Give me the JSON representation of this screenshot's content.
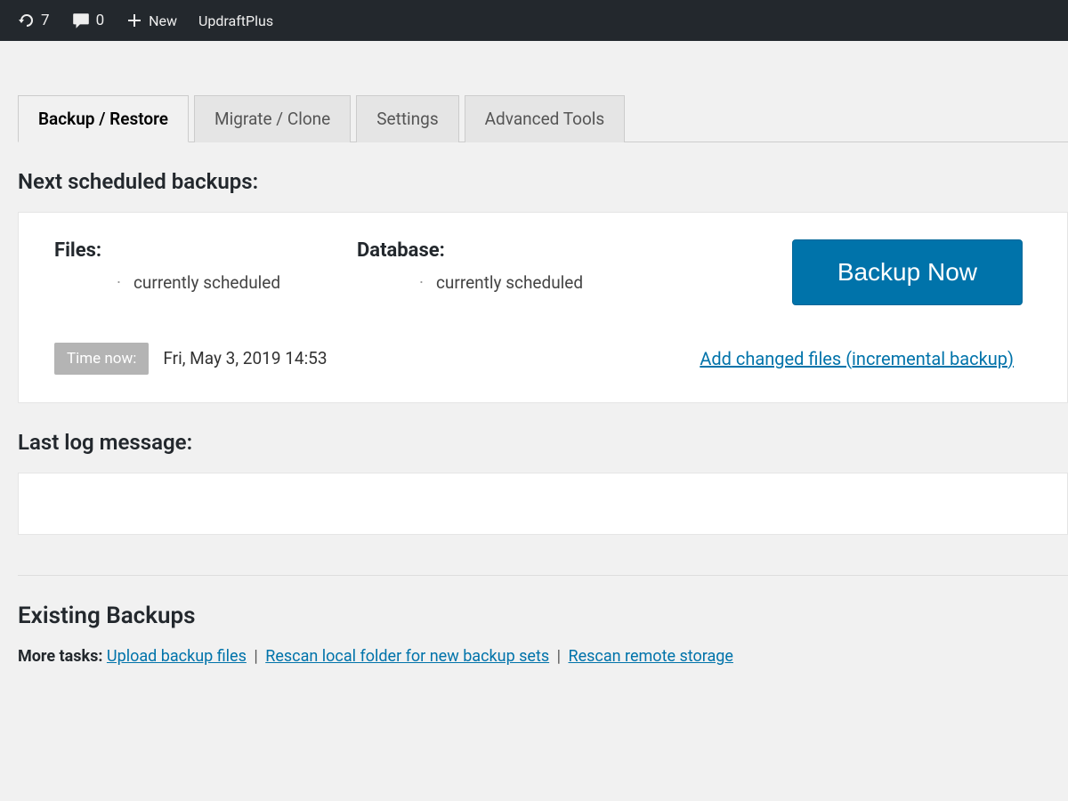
{
  "adminBar": {
    "updates": {
      "count": "7"
    },
    "comments": {
      "count": "0"
    },
    "new": {
      "label": "New"
    },
    "updraft": {
      "label": "UpdraftPlus"
    }
  },
  "tabs": [
    {
      "label": "Backup / Restore",
      "active": true
    },
    {
      "label": "Migrate / Clone",
      "active": false
    },
    {
      "label": "Settings",
      "active": false
    },
    {
      "label": "Advanced Tools",
      "active": false
    }
  ],
  "sections": {
    "nextScheduledHeading": "Next scheduled backups:",
    "lastLogHeading": "Last log message:",
    "existingHeading": "Existing Backups"
  },
  "schedule": {
    "filesLabel": "Files:",
    "filesStatus": "currently scheduled",
    "dbLabel": "Database:",
    "dbStatus": "currently scheduled",
    "backupNowLabel": "Backup Now",
    "timeNowLabel": "Time now:",
    "timeNowValue": "Fri, May 3, 2019 14:53",
    "incrementalLink": "Add changed files (incremental backup)"
  },
  "moreTasks": {
    "prefix": "More tasks:",
    "links": [
      "Upload backup files",
      "Rescan local folder for new backup sets",
      "Rescan remote storage"
    ],
    "separator": "|"
  }
}
